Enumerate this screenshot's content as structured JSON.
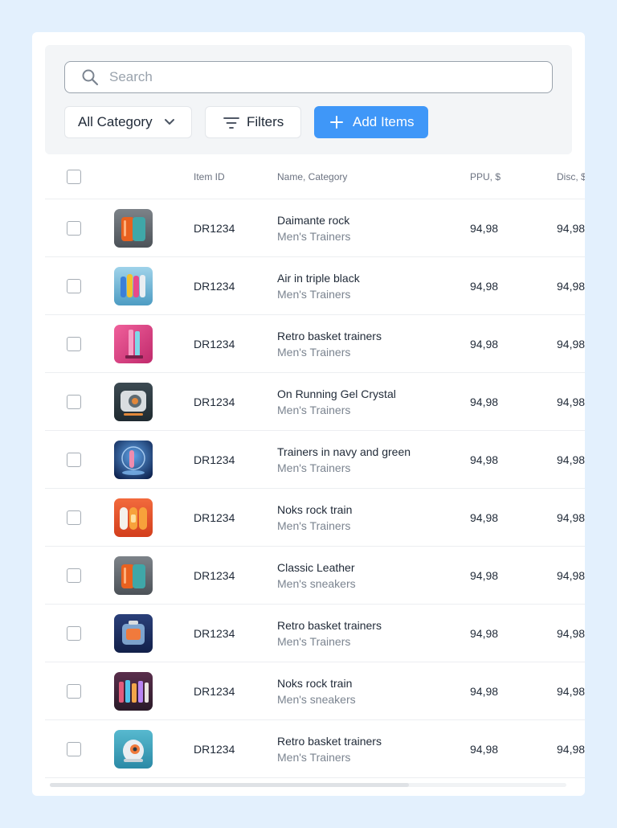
{
  "search": {
    "placeholder": "Search",
    "value": ""
  },
  "toolbar": {
    "category_label": "All Category",
    "filters_label": "Filters",
    "add_label": "Add Items"
  },
  "columns": {
    "item_id": "Item ID",
    "name_category": "Name, Category",
    "ppu": "PPU, $",
    "disc": "Disc, $"
  },
  "rows": [
    {
      "id": "DR1234",
      "name": "Daimante rock",
      "category": "Men's Trainers",
      "ppu": "94,98",
      "disc": "94,98",
      "thumb": "orange-teal-device"
    },
    {
      "id": "DR1234",
      "name": "Air in triple black",
      "category": "Men's Trainers",
      "ppu": "94,98",
      "disc": "94,98",
      "thumb": "colored-bottles"
    },
    {
      "id": "DR1234",
      "name": "Retro basket trainers",
      "category": "Men's Trainers",
      "ppu": "94,98",
      "disc": "94,98",
      "thumb": "pink-bottles"
    },
    {
      "id": "DR1234",
      "name": "On Running Gel Crystal",
      "category": "Men's Trainers",
      "ppu": "94,98",
      "disc": "94,98",
      "thumb": "silver-device"
    },
    {
      "id": "DR1234",
      "name": "Trainers in navy and green",
      "category": "Men's Trainers",
      "ppu": "94,98",
      "disc": "94,98",
      "thumb": "blue-sphere"
    },
    {
      "id": "DR1234",
      "name": "Noks rock train",
      "category": "Men's Trainers",
      "ppu": "94,98",
      "disc": "94,98",
      "thumb": "orange-cylinders"
    },
    {
      "id": "DR1234",
      "name": "Classic Leather",
      "category": "Men's sneakers",
      "ppu": "94,98",
      "disc": "94,98",
      "thumb": "orange-teal-device"
    },
    {
      "id": "DR1234",
      "name": "Retro basket trainers",
      "category": "Men's Trainers",
      "ppu": "94,98",
      "disc": "94,98",
      "thumb": "glass-cube"
    },
    {
      "id": "DR1234",
      "name": "Noks rock train",
      "category": "Men's sneakers",
      "ppu": "94,98",
      "disc": "94,98",
      "thumb": "bottles-shelf"
    },
    {
      "id": "DR1234",
      "name": "Retro basket trainers",
      "category": "Men's Trainers",
      "ppu": "94,98",
      "disc": "94,98",
      "thumb": "teal-robot"
    }
  ],
  "colors": {
    "page_bg": "#e3f0fd",
    "accent": "#3f97f8",
    "toolbar_bg": "#f3f5f7"
  },
  "icons": [
    "search-icon",
    "chevron-down-icon",
    "filter-icon",
    "plus-icon"
  ]
}
